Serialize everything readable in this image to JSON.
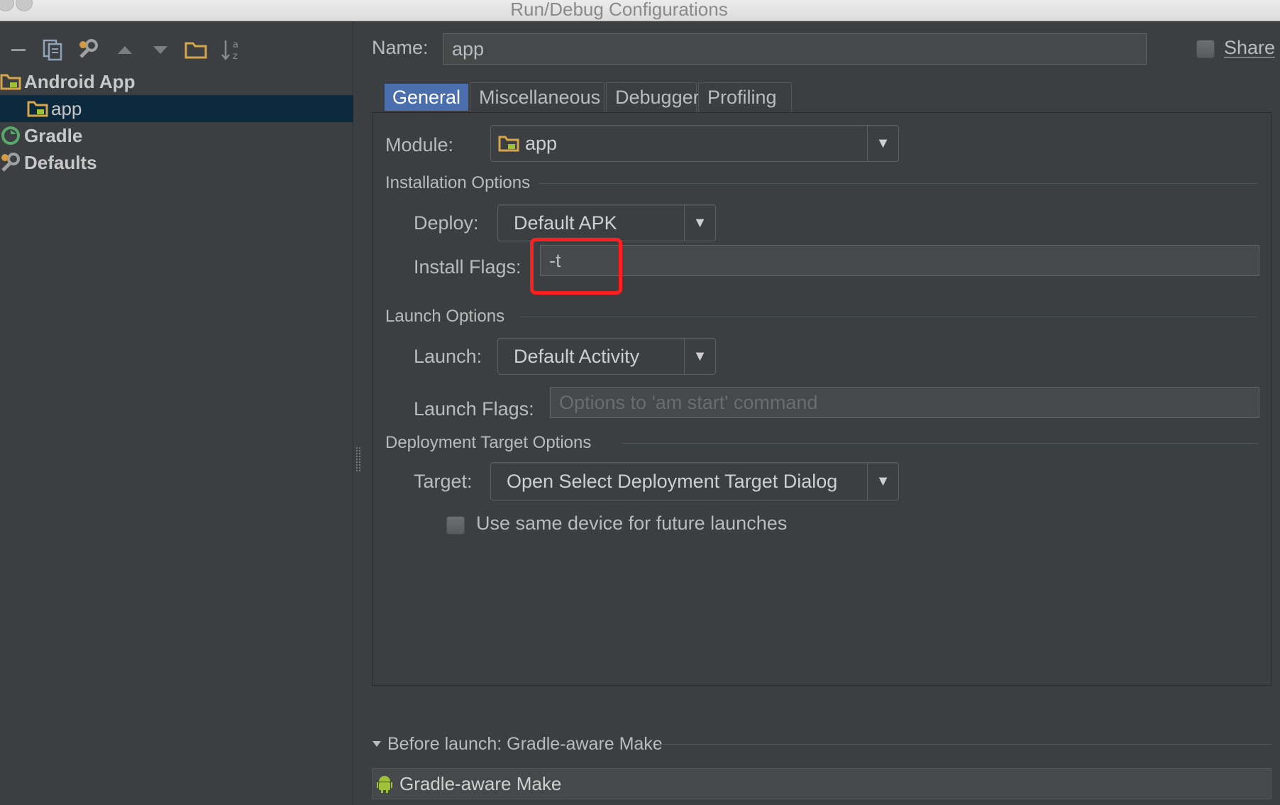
{
  "window": {
    "title": "Run/Debug Configurations"
  },
  "toolbar": {
    "icons": [
      "minus-icon",
      "copy-icon",
      "edit-defaults-icon",
      "move-up-icon",
      "move-down-icon",
      "folder-icon",
      "sort-az-icon"
    ]
  },
  "tree": {
    "items": [
      {
        "label": "Android App",
        "icon": "android-app-icon"
      },
      {
        "label": "app",
        "icon": "android-app-icon"
      },
      {
        "label": "Gradle",
        "icon": "gradle-icon"
      },
      {
        "label": "Defaults",
        "icon": "wrench-icon"
      }
    ]
  },
  "header": {
    "name_label": "Name:",
    "name_value": "app",
    "share_label": "Share"
  },
  "tabs": [
    {
      "label": "General",
      "active": true
    },
    {
      "label": "Miscellaneous",
      "active": false
    },
    {
      "label": "Debugger",
      "active": false
    },
    {
      "label": "Profiling",
      "active": false
    }
  ],
  "general": {
    "module_label": "Module:",
    "module_value": "app",
    "installation_section": "Installation Options",
    "deploy_label": "Deploy:",
    "deploy_value": "Default APK",
    "install_flags_label": "Install Flags:",
    "install_flags_value": "-t",
    "launch_section": "Launch Options",
    "launch_label": "Launch:",
    "launch_value": "Default Activity",
    "launch_flags_label": "Launch Flags:",
    "launch_flags_placeholder": "Options to 'am start' command",
    "deployment_section": "Deployment Target Options",
    "target_label": "Target:",
    "target_value": "Open Select Deployment Target Dialog",
    "same_device_label": "Use same device for future launches"
  },
  "before_launch": {
    "header": "Before launch: Gradle-aware Make",
    "item": "Gradle-aware Make"
  },
  "colors": {
    "highlight": "#ff1f1f",
    "selected_tab": "#4b6eaf",
    "selected_row": "#0d293e"
  }
}
